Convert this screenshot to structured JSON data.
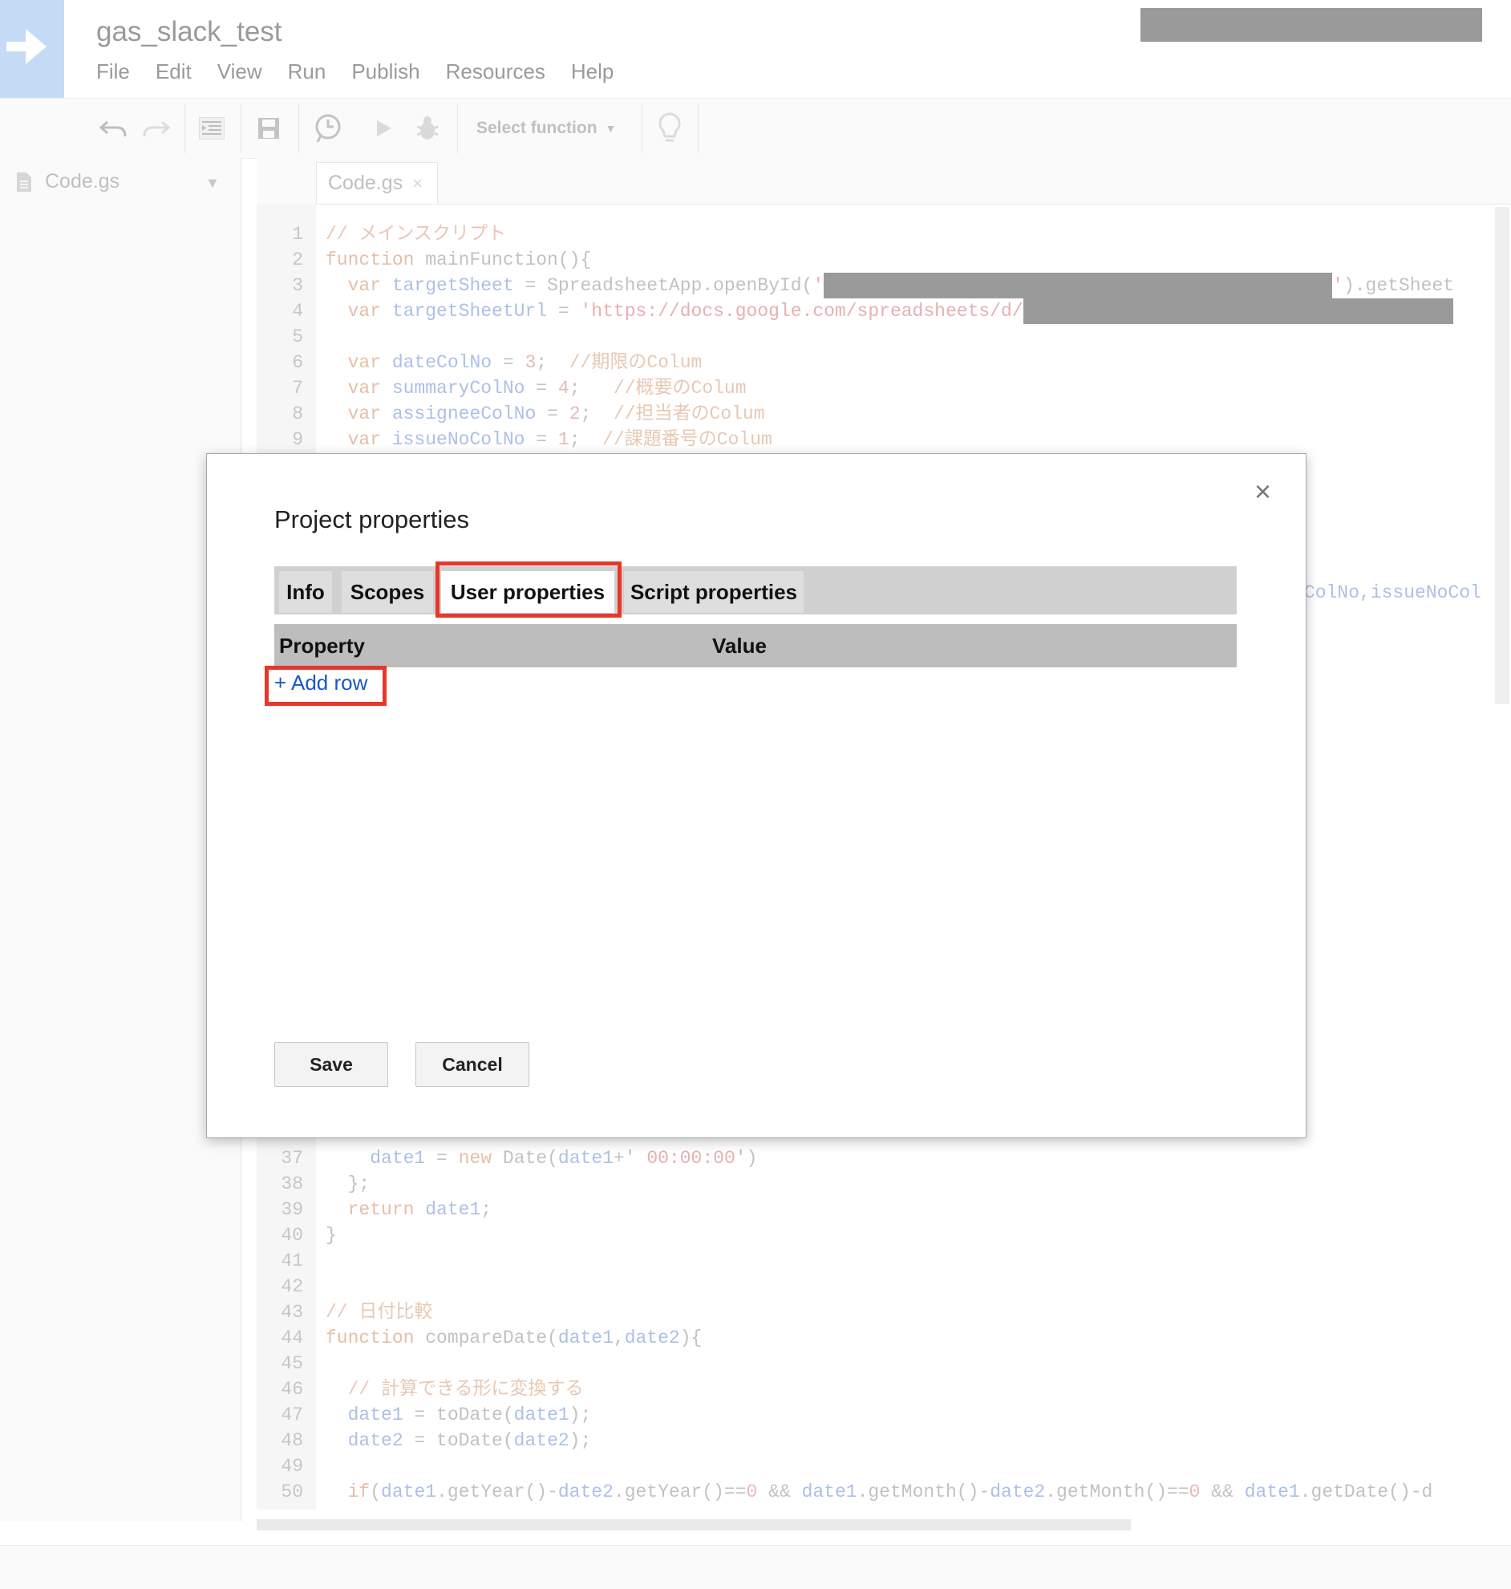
{
  "app": {
    "title": "gas_slack_test",
    "menu": [
      "File",
      "Edit",
      "View",
      "Run",
      "Publish",
      "Resources",
      "Help"
    ]
  },
  "toolbar": {
    "select_function": "Select function"
  },
  "files": {
    "items": [
      "Code.gs"
    ]
  },
  "editor": {
    "tab": "Code.gs",
    "lines": [
      {
        "n": "1"
      },
      {
        "n": "2"
      },
      {
        "n": "3"
      },
      {
        "n": "4"
      },
      {
        "n": "5"
      },
      {
        "n": "6"
      },
      {
        "n": "7"
      },
      {
        "n": "8"
      },
      {
        "n": "9"
      },
      {
        "n": "37"
      },
      {
        "n": "38"
      },
      {
        "n": "39"
      },
      {
        "n": "40"
      },
      {
        "n": "41"
      },
      {
        "n": "42"
      },
      {
        "n": "43"
      },
      {
        "n": "44"
      },
      {
        "n": "45"
      },
      {
        "n": "46"
      },
      {
        "n": "47"
      },
      {
        "n": "48"
      },
      {
        "n": "49"
      },
      {
        "n": "50"
      }
    ],
    "text": {
      "l1": "// メインスクリプト",
      "l2_kw": "function",
      "l2": " mainFunction(){",
      "l3_kw": "  var ",
      "l3_var": "targetSheet",
      "l3_a": " = SpreadsheetApp.openById(",
      "l3_q": "'",
      "l3_q2": "'",
      "l3_b": ").getSheet",
      "l4_kw": "  var ",
      "l4_var": "targetSheetUrl",
      "l4_a": " = ",
      "l4_str": "'https://docs.google.com/spreadsheets/d/",
      "l6_kw": "  var ",
      "l6_var": "dateColNo",
      "l6_a": " = ",
      "l6_num": "3",
      "l6_b": ";  ",
      "l6_cm": "//期限のColum",
      "l7_kw": "  var ",
      "l7_var": "summaryColNo",
      "l7_a": " = ",
      "l7_num": "4",
      "l7_b": ";   ",
      "l7_cm": "//概要のColum",
      "l8_kw": "  var ",
      "l8_var": "assigneeColNo",
      "l8_a": " = ",
      "l8_num": "2",
      "l8_b": ";  ",
      "l8_cm": "//担当者のColum",
      "l9_kw": "  var ",
      "l9_var": "issueNoColNo",
      "l9_a": " = ",
      "l9_num": "1",
      "l9_b": ";  ",
      "l9_cm": "//課題番号のColum",
      "frag": "ColNo,issueNoCol",
      "l37_a": "    ",
      "l37_var": "date1",
      "l37_b": " = ",
      "l37_kw": "new",
      "l37_c": " Date(",
      "l37_var2": "date1",
      "l37_d": "+",
      "l37_str": "' 00:00:00'",
      "l37_e": ")",
      "l38": "  };",
      "l39_kw": "  return ",
      "l39_var": "date1",
      "l39_b": ";",
      "l40": "}",
      "l43": "// 日付比較",
      "l44_kw": "function",
      "l44_a": " compareDate(",
      "l44_v1": "date1",
      "l44_b": ",",
      "l44_v2": "date2",
      "l44_c": "){",
      "l46": "  // 計算できる形に変換する",
      "l47_a": "  ",
      "l47_v": "date1",
      "l47_b": " = toDate(",
      "l47_v2": "date1",
      "l47_c": ");",
      "l48_a": "  ",
      "l48_v": "date2",
      "l48_b": " = toDate(",
      "l48_v2": "date2",
      "l48_c": ");",
      "l50_kw": "  if",
      "l50_a": "(",
      "l50_v1": "date1",
      "l50_b": ".getYear()-",
      "l50_v2": "date2",
      "l50_c": ".getYear()==",
      "l50_n1": "0",
      "l50_d": " && ",
      "l50_v3": "date1",
      "l50_e": ".getMonth()-",
      "l50_v4": "date2",
      "l50_f": ".getMonth()==",
      "l50_n2": "0",
      "l50_g": " && ",
      "l50_v5": "date1",
      "l50_h": ".getDate()-d"
    }
  },
  "dialog": {
    "title": "Project properties",
    "tabs": [
      "Info",
      "Scopes",
      "User properties",
      "Script properties"
    ],
    "active_tab": "User properties",
    "columns": [
      "Property",
      "Value"
    ],
    "add_row": "+ Add row",
    "save": "Save",
    "cancel": "Cancel",
    "close": "×"
  },
  "colors": {
    "highlight": "#e8372a",
    "link": "#1a56c4",
    "redaction": "#9a9a9a"
  }
}
